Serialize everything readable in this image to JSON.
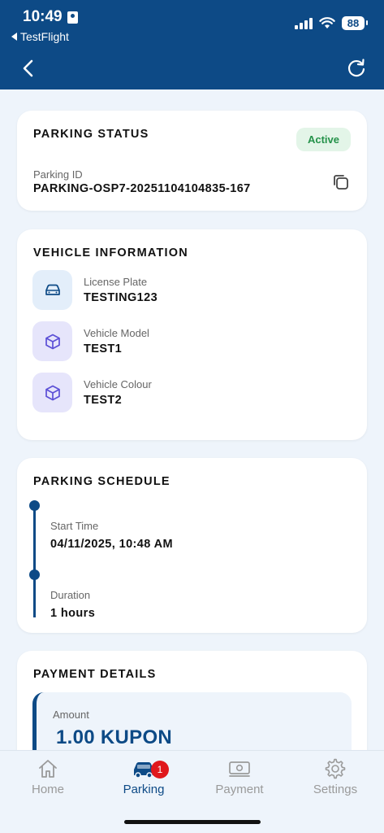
{
  "status_bar": {
    "time": "10:49",
    "back_app": "TestFlight",
    "battery": "88"
  },
  "parking_status": {
    "title": "PARKING STATUS",
    "badge": "Active",
    "id_label": "Parking ID",
    "id_value": "PARKING-OSP7-20251104104835-167"
  },
  "vehicle": {
    "title": "VEHICLE INFORMATION",
    "items": [
      {
        "label": "License Plate",
        "value": "TESTING123",
        "icon": "car-icon"
      },
      {
        "label": "Vehicle Model",
        "value": "TEST1",
        "icon": "cube-icon"
      },
      {
        "label": "Vehicle Colour",
        "value": "TEST2",
        "icon": "cube-icon"
      }
    ]
  },
  "schedule": {
    "title": "PARKING SCHEDULE",
    "start_label": "Start Time",
    "start_value": "04/11/2025, 10:48 AM",
    "duration_label": "Duration",
    "duration_value": "1 hours"
  },
  "payment": {
    "title": "PAYMENT DETAILS",
    "amount_label": "Amount",
    "amount_value": "1.00 KUPON"
  },
  "tabs": [
    {
      "label": "Home",
      "icon": "home-icon"
    },
    {
      "label": "Parking",
      "icon": "car-icon",
      "badge": "1"
    },
    {
      "label": "Payment",
      "icon": "cash-icon"
    },
    {
      "label": "Settings",
      "icon": "gear-icon"
    }
  ],
  "colors": {
    "primary": "#0d4a86",
    "active_badge_bg": "#e3f5e8",
    "active_badge_text": "#24924a",
    "notif": "#e0181c"
  }
}
